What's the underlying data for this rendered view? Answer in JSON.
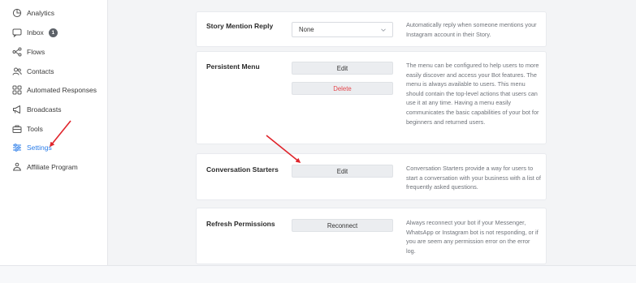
{
  "sidebar": {
    "items": [
      {
        "label": "Analytics",
        "icon": "analytics-icon"
      },
      {
        "label": "Inbox",
        "icon": "inbox-icon",
        "badge": "1"
      },
      {
        "label": "Flows",
        "icon": "flows-icon"
      },
      {
        "label": "Contacts",
        "icon": "contacts-icon"
      },
      {
        "label": "Automated Responses",
        "icon": "automated-responses-icon"
      },
      {
        "label": "Broadcasts",
        "icon": "megaphone-icon"
      },
      {
        "label": "Tools",
        "icon": "toolbox-icon"
      },
      {
        "label": "Settings",
        "icon": "sliders-icon",
        "active": true
      },
      {
        "label": "Affiliate Program",
        "icon": "affiliate-icon"
      }
    ]
  },
  "settings": {
    "story_mention": {
      "title": "Story Mention Reply",
      "select_value": "None",
      "description": "Automatically reply when someone mentions your Instagram account in their Story."
    },
    "persistent_menu": {
      "title": "Persistent Menu",
      "edit_label": "Edit",
      "delete_label": "Delete",
      "description": "The menu can be configured to help users to more easily discover and access your Bot features. The menu is always available to users. This menu should contain the top-level actions that users can use it at any time. Having a menu easily communicates the basic capabilities of your bot for beginners and returned users."
    },
    "conversation_starters": {
      "title": "Conversation Starters",
      "edit_label": "Edit",
      "description": "Conversation Starters provide a way for users to start a conversation with your business with a list of frequently asked questions."
    },
    "refresh_permissions": {
      "title": "Refresh Permissions",
      "reconnect_label": "Reconnect",
      "description": "Always reconnect your bot if your Messenger, WhatsApp or Instagram bot is not responding, or if you are seem any permission error on the error log."
    }
  },
  "colors": {
    "accent": "#2b7de9",
    "danger": "#e5484d",
    "annotation_arrow": "#e0242b"
  }
}
